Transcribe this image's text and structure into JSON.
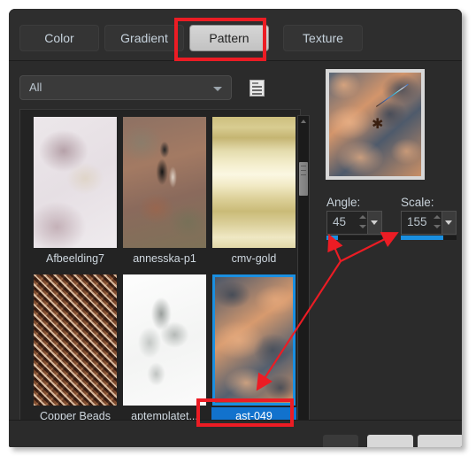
{
  "window": {
    "tabs": [
      {
        "id": "color",
        "label": "Color",
        "active": false
      },
      {
        "id": "gradient",
        "label": "Gradient",
        "active": false
      },
      {
        "id": "pattern",
        "label": "Pattern",
        "active": true
      },
      {
        "id": "texture",
        "label": "Texture",
        "active": false
      }
    ]
  },
  "filter": {
    "selected": "All",
    "dropdown_icon": "chevron-down-icon",
    "list_icon": "list-view-icon"
  },
  "patterns": {
    "items": [
      {
        "name": "Afbeelding7",
        "selected": false
      },
      {
        "name": "annesska-p1",
        "selected": false
      },
      {
        "name": "cmv-gold",
        "selected": false
      },
      {
        "name": "Copper Beads",
        "selected": false
      },
      {
        "name": "aptemplatet...",
        "selected": false
      },
      {
        "name": "ast-049",
        "selected": true
      }
    ],
    "scrollbar": {
      "up_icon": "chevron-up-icon",
      "down_icon": "chevron-down-icon"
    }
  },
  "preview": {
    "alt": "pattern-preview-ast-049",
    "marker_icon": "asterisk-marker-icon"
  },
  "controls": {
    "angle": {
      "label": "Angle:",
      "value": "45",
      "slider_percent": 20,
      "stepper_icon": "spinner-arrows-icon",
      "dropdown_icon": "chevron-down-icon"
    },
    "scale": {
      "label": "Scale:",
      "value": "155",
      "slider_percent": 76,
      "stepper_icon": "spinner-arrows-icon",
      "dropdown_icon": "chevron-down-icon"
    }
  },
  "colors": {
    "accent_blue": "#1a8fe0",
    "selection_blue": "#1272cd",
    "annotation_red": "#ec1c24",
    "panel_bg": "#2b2b2b",
    "grid_bg": "#232323"
  },
  "annotations": {
    "highlight_pattern_tab": "red-rectangle-pattern-tab",
    "highlight_selected_swatch": "red-rectangle-ast-049",
    "arrow_to_angle": "red-arrow-angle-slider",
    "arrow_to_scale": "red-arrow-scale-slider",
    "arrow_to_swatch": "red-arrow-selected-swatch"
  }
}
